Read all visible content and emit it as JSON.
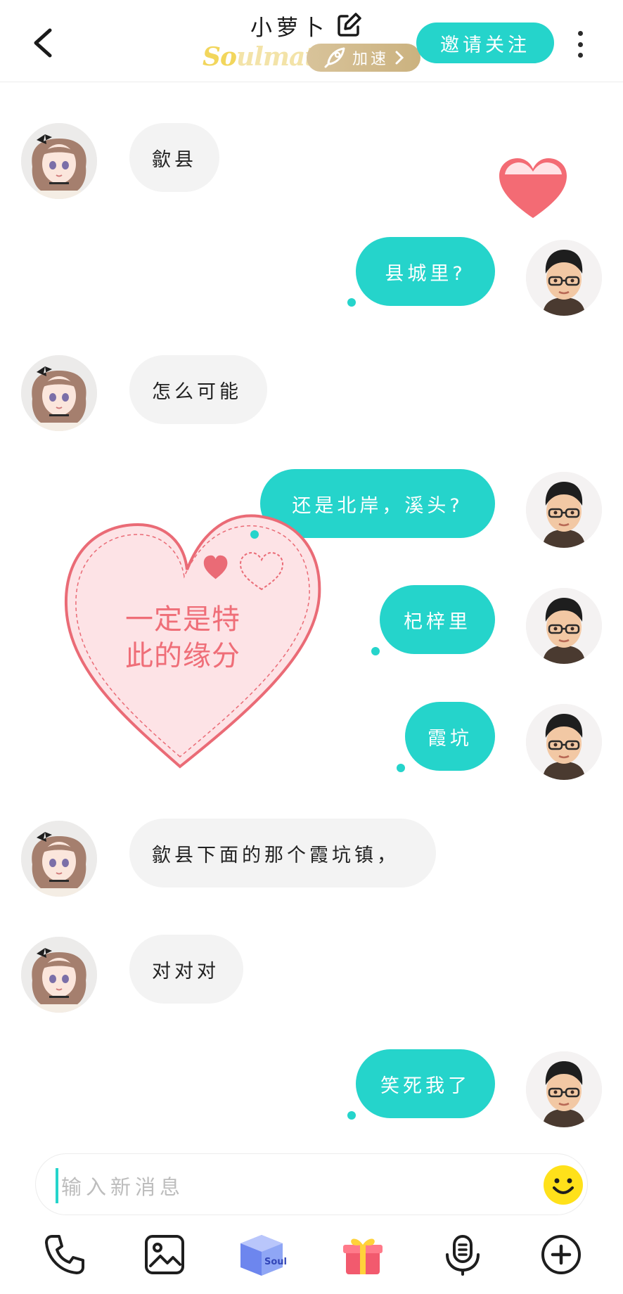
{
  "header": {
    "title": "小萝卜",
    "brand_prefix": "So",
    "brand_suffix": "ulmate",
    "speed_label": "加速",
    "invite_label": "邀请关注"
  },
  "messages": [
    {
      "side": "in",
      "text": "歙县"
    },
    {
      "side": "out",
      "text": "县城里?"
    },
    {
      "side": "in",
      "text": "怎么可能"
    },
    {
      "side": "out",
      "text": "还是北岸，溪头?"
    },
    {
      "side": "out",
      "text": "杞梓里"
    },
    {
      "side": "out",
      "text": "霞坑"
    },
    {
      "side": "in",
      "text": "歙县下面的那个霞坑镇，"
    },
    {
      "side": "in",
      "text": "对对对"
    },
    {
      "side": "out",
      "text": "笑死我了"
    }
  ],
  "sticker": {
    "line1": "一定是特",
    "line2": "此的缘分"
  },
  "input": {
    "placeholder": "输入新消息"
  },
  "toolbar": [
    {
      "icon": "phone-icon"
    },
    {
      "icon": "image-icon"
    },
    {
      "icon": "soul-box-icon"
    },
    {
      "icon": "gift-icon"
    },
    {
      "icon": "voice-icon"
    },
    {
      "icon": "plus-icon"
    }
  ],
  "colors": {
    "accent": "#25d4cb",
    "incoming_bubble": "#f3f3f3",
    "sticker_text": "#ef6e78",
    "heart_red": "#f36b74"
  }
}
